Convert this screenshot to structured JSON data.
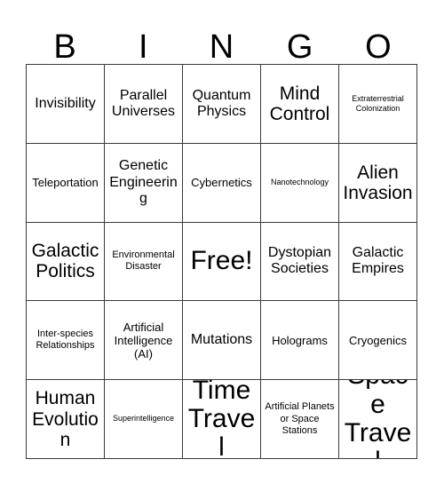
{
  "card": {
    "header_letters": [
      "B",
      "I",
      "N",
      "G",
      "O"
    ],
    "columns": 5,
    "rows": 5,
    "border_color": "#3a3a3a",
    "background_color": "#ffffff",
    "text_color": "#000000",
    "free_space_label": "Free!",
    "free_space_position": "row3-col3"
  },
  "cells": [
    {
      "text": "Invisibility",
      "size": "md"
    },
    {
      "text": "Parallel Universes",
      "size": "md"
    },
    {
      "text": "Quantum Physics",
      "size": "md"
    },
    {
      "text": "Mind Control",
      "size": "lg"
    },
    {
      "text": "Extraterrestrial Colonization",
      "size": "xxs"
    },
    {
      "text": "Teleportation",
      "size": "sm"
    },
    {
      "text": "Genetic Engineering",
      "size": "md"
    },
    {
      "text": "Cybernetics",
      "size": "sm"
    },
    {
      "text": "Nanotechnology",
      "size": "xxs"
    },
    {
      "text": "Alien Invasion",
      "size": "lg"
    },
    {
      "text": "Galactic Politics",
      "size": "lg"
    },
    {
      "text": "Environmental Disaster",
      "size": "xs"
    },
    {
      "text": "Free!",
      "size": "xl"
    },
    {
      "text": "Dystopian Societies",
      "size": "md"
    },
    {
      "text": "Galactic Empires",
      "size": "md"
    },
    {
      "text": "Inter-species Relationships",
      "size": "xs"
    },
    {
      "text": "Artificial Intelligence (AI)",
      "size": "sm"
    },
    {
      "text": "Mutations",
      "size": "md"
    },
    {
      "text": "Holograms",
      "size": "sm"
    },
    {
      "text": "Cryogenics",
      "size": "sm"
    },
    {
      "text": "Human Evolution",
      "size": "lg"
    },
    {
      "text": "Superintelligence",
      "size": "xxs"
    },
    {
      "text": "Time Travel",
      "size": "xl"
    },
    {
      "text": "Artificial Planets or Space Stations",
      "size": "xs"
    },
    {
      "text": "Space Travel",
      "size": "xl"
    }
  ]
}
